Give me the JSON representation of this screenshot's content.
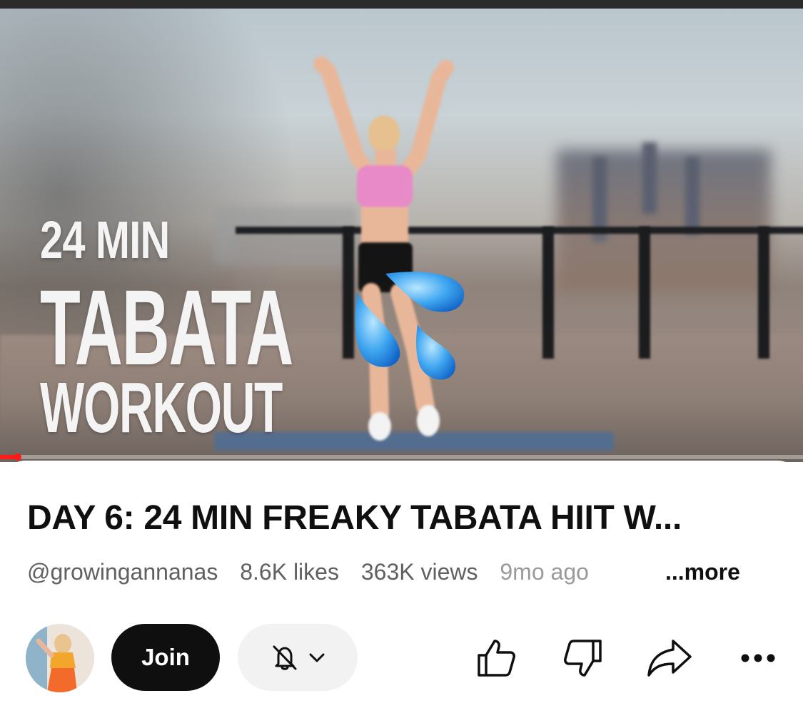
{
  "video": {
    "overlay_line1": "24 MIN",
    "overlay_line2": "TABATA",
    "overlay_line3": "WORKOUT",
    "progress_fraction": 0.022,
    "accent_color": "#ff1a1a"
  },
  "details": {
    "title": "DAY 6: 24 MIN FREAKY TABATA HIIT W...",
    "channel_handle": "@growingannanas",
    "likes": "8.6K likes",
    "views": "363K views",
    "age": "9mo ago",
    "more_label": "...more"
  },
  "actions": {
    "join_label": "Join",
    "icons": [
      "bell-off-icon",
      "chevron-down-icon",
      "thumbs-up-icon",
      "thumbs-down-icon",
      "share-icon",
      "more-icon"
    ]
  }
}
